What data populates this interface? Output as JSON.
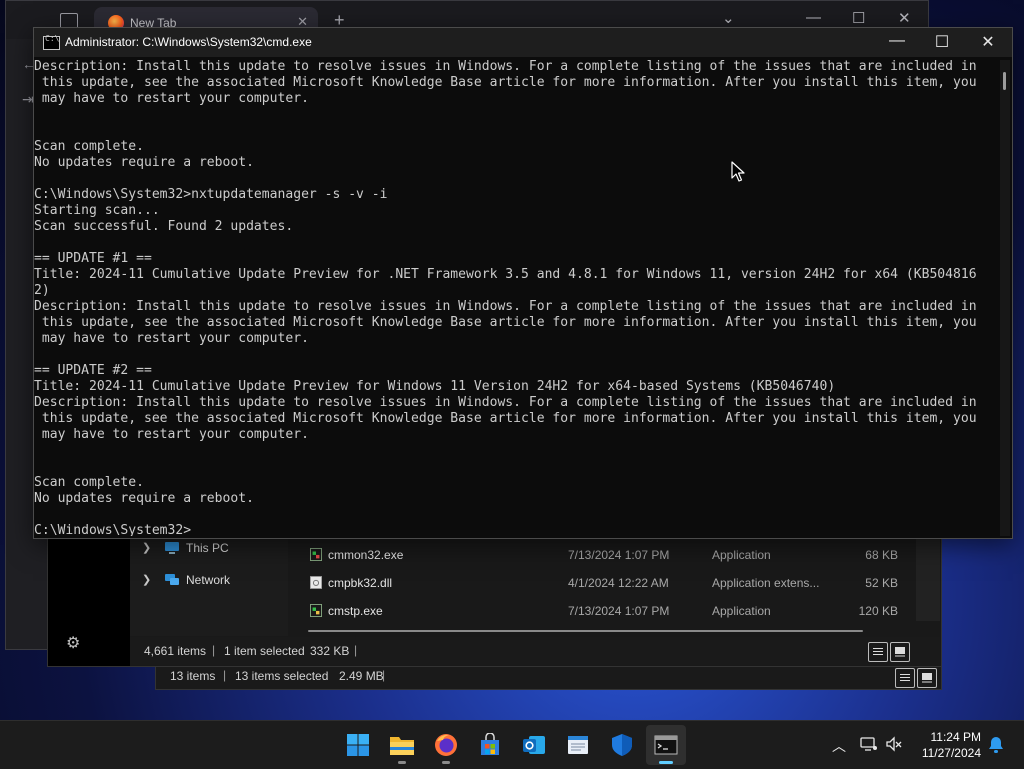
{
  "browser": {
    "tab_title": "New Tab",
    "tab_close": "✕",
    "new_tab": "+",
    "controls": {
      "dropdown": "⌄",
      "minimize": "—",
      "maximize": "☐",
      "close": "✕"
    }
  },
  "explorer": {
    "nav": [
      {
        "label": "This PC",
        "icon": "pc-icon"
      },
      {
        "label": "Network",
        "icon": "network-icon"
      }
    ],
    "files": [
      {
        "name": "cmmon32.exe",
        "date": "7/13/2024 1:07 PM",
        "type": "Application",
        "size": "68 KB",
        "icon": "exe-icon"
      },
      {
        "name": "cmpbk32.dll",
        "date": "4/1/2024 12:22 AM",
        "type": "Application extens...",
        "size": "52 KB",
        "icon": "dll-icon"
      },
      {
        "name": "cmstp.exe",
        "date": "7/13/2024 1:07 PM",
        "type": "Application",
        "size": "120 KB",
        "icon": "exe-icon"
      }
    ],
    "status": {
      "items": "4,661 items",
      "selected": "1 item selected",
      "size": "332 KB"
    }
  },
  "explorer2": {
    "status": {
      "items": "13 items",
      "selected": "13 items selected",
      "size": "2.49 MB"
    }
  },
  "cmd": {
    "title": "Administrator: C:\\Windows\\System32\\cmd.exe",
    "icon_glyph": "C:\\",
    "controls": {
      "minimize": "—",
      "maximize": "☐",
      "close": "✕"
    },
    "lines": [
      "Description: Install this update to resolve issues in Windows. For a complete listing of the issues that are included in",
      " this update, see the associated Microsoft Knowledge Base article for more information. After you install this item, you",
      " may have to restart your computer.",
      "",
      "",
      "Scan complete.",
      "No updates require a reboot.",
      "",
      "C:\\Windows\\System32>nxtupdatemanager -s -v -i",
      "Starting scan...",
      "Scan successful. Found 2 updates.",
      "",
      "== UPDATE #1 ==",
      "Title: 2024-11 Cumulative Update Preview for .NET Framework 3.5 and 4.8.1 for Windows 11, version 24H2 for x64 (KB504816",
      "2)",
      "Description: Install this update to resolve issues in Windows. For a complete listing of the issues that are included in",
      " this update, see the associated Microsoft Knowledge Base article for more information. After you install this item, you",
      " may have to restart your computer.",
      "",
      "== UPDATE #2 ==",
      "Title: 2024-11 Cumulative Update Preview for Windows 11 Version 24H2 for x64-based Systems (KB5046740)",
      "Description: Install this update to resolve issues in Windows. For a complete listing of the issues that are included in",
      " this update, see the associated Microsoft Knowledge Base article for more information. After you install this item, you",
      " may have to restart your computer.",
      "",
      "",
      "Scan complete.",
      "No updates require a reboot.",
      "",
      "C:\\Windows\\System32>"
    ]
  },
  "taskbar": {
    "apps": [
      {
        "name": "start",
        "icon": "windows-logo-icon",
        "running": false
      },
      {
        "name": "file-explorer",
        "icon": "folder-icon",
        "running": true
      },
      {
        "name": "firefox",
        "icon": "firefox-icon",
        "running": true
      },
      {
        "name": "microsoft-store",
        "icon": "store-icon",
        "running": false
      },
      {
        "name": "outlook",
        "icon": "outlook-icon",
        "running": false
      },
      {
        "name": "notepad",
        "icon": "notepad-icon",
        "running": false
      },
      {
        "name": "windows-security",
        "icon": "shield-icon",
        "running": false
      },
      {
        "name": "command-prompt",
        "icon": "terminal-icon",
        "running": true,
        "active": true
      }
    ],
    "tray": {
      "time": "11:24 PM",
      "date": "11/27/2024"
    }
  },
  "colors": {
    "console_text": "#cccccc",
    "console_bg": "#0c0c0c",
    "accent": "#60cdff",
    "taskbar_bg": "#1c1c1c"
  }
}
